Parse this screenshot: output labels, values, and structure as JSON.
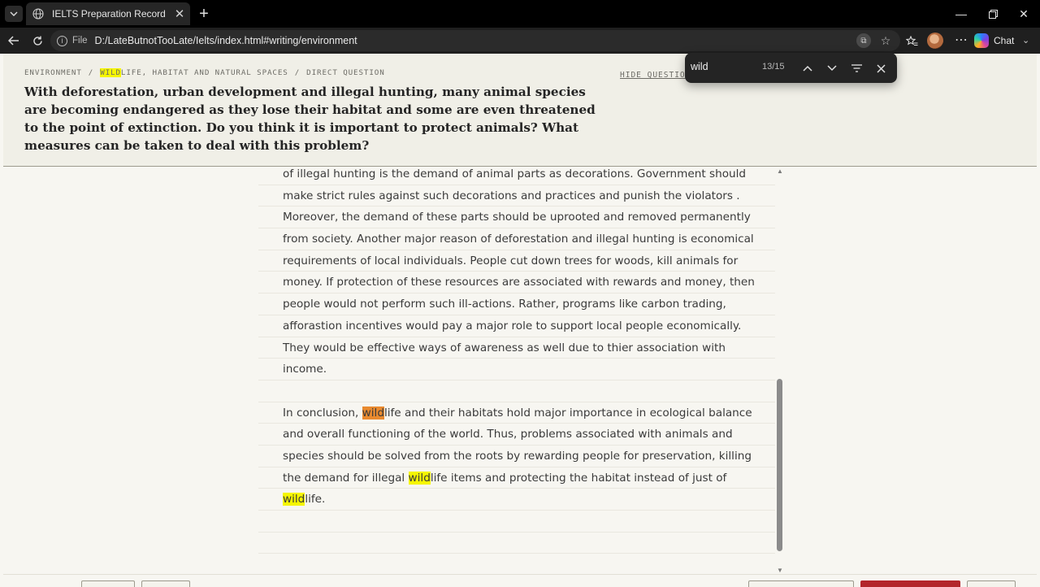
{
  "browser": {
    "tab_title": "IELTS Preparation Record",
    "url_scheme": "File",
    "url": "D:/LateButnotTooLate/Ielts/index.html#writing/environment",
    "chat_label": "Chat"
  },
  "find": {
    "query": "wild",
    "count": "13/15"
  },
  "breadcrumb": {
    "part1": "ENVIRONMENT",
    "sep": "/",
    "part2_match": "WILD",
    "part2_rest": "LIFE, HABITAT AND NATURAL SPACES",
    "part3": "DIRECT QUESTION"
  },
  "hide_question": "HIDE QUESTION",
  "question": "With deforestation, urban development and illegal hunting, many animal species are becoming endangered as they lose their habitat and some are even threatened to the point of extinction. Do you think it is important to protect animals? What measures can be taken to deal with this problem?",
  "essay": {
    "lines": [
      "of illegal hunting is the demand of animal parts as decorations. Government should",
      "make strict rules against such decorations and practices and punish the violators .",
      "Moreover, the demand of these parts should be uprooted and removed permanently",
      "from society. Another major reason of deforestation and illegal hunting is economical",
      "requirements of local individuals. People cut down trees for woods, kill animals for",
      "money. If protection of these resources are associated with rewards and money, then",
      "people would not perform such ill-actions. Rather, programs like carbon trading,",
      "afforastion incentives would pay a major role to support local people economically.",
      "They would be effective ways of awareness as well due to thier association with",
      "income."
    ],
    "conclusion": {
      "l1_pre": "In conclusion, ",
      "l1_match": "wild",
      "l1_post": "life and their habitats hold major importance in ecological balance",
      "l2": "and overall functioning of the world. Thus, problems associated with animals and",
      "l3": "species should be solved from the roots by rewarding people for preservation, killing",
      "l4_pre": "the demand for illegal ",
      "l4_match": "wild",
      "l4_post": "life items and protecting the habitat instead of just of",
      "l5_match": "wild",
      "l5_post": "life."
    }
  },
  "colors": {
    "match_highlight": "#f5f500",
    "current_match": "#e98a2f",
    "primary_button": "#b3262b"
  }
}
